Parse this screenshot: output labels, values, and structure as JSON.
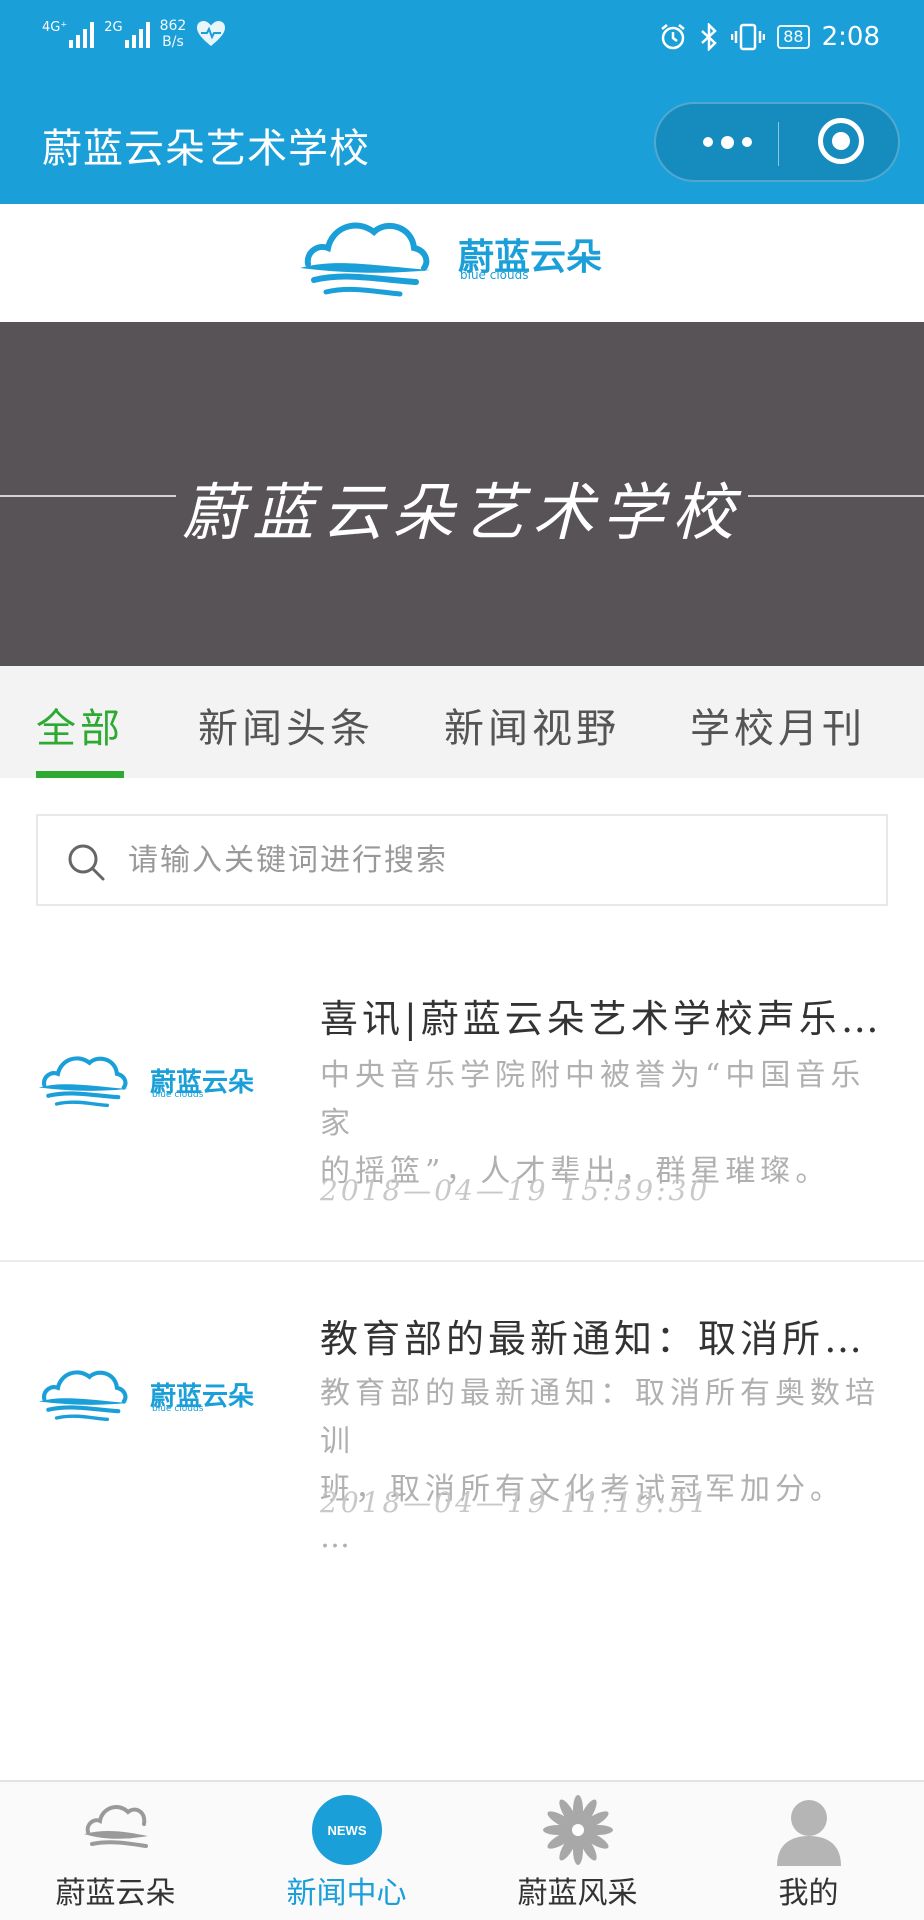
{
  "status_bar": {
    "network_left": "4G⁺",
    "network_right": "2G",
    "speed_value": "862",
    "speed_unit": "B/s",
    "battery": "88",
    "time": "2:08"
  },
  "header": {
    "title": "蔚蓝云朵艺术学校",
    "more_icon": "more-dots-icon",
    "close_icon": "target-circle-icon",
    "brand_color": "#1a9fd9"
  },
  "logo": {
    "name": "蔚蓝云朵",
    "sub": "blue clouds"
  },
  "banner": {
    "title": "蔚蓝云朵艺术学校"
  },
  "tabs": {
    "items": [
      {
        "label": "全部"
      },
      {
        "label": "新闻头条"
      },
      {
        "label": "新闻视野"
      },
      {
        "label": "学校月刊"
      }
    ],
    "active": "全部",
    "active_color": "#2eaa33"
  },
  "search": {
    "placeholder": "请输入关键词进行搜索",
    "value": ""
  },
  "news": [
    {
      "title": "喜讯|蔚蓝云朵艺术学校声乐…",
      "summary_line1": "中央音乐学院附中被誉为“中国音乐家",
      "summary_line2": "的摇篮”，人才辈出，群星璀璨。",
      "date": "2018—04—19  15:59:30"
    },
    {
      "title": "教育部的最新通知：取消所…",
      "summary_line1": "教育部的最新通知：取消所有奥数培训",
      "summary_line2": "班，取消所有文化考试冠军加分。 …",
      "date": "2018—04—19  11:19:51"
    }
  ],
  "tabbar": {
    "items": [
      {
        "label": "蔚蓝云朵",
        "icon": "cloud-icon"
      },
      {
        "label": "新闻中心",
        "icon": "news-icon",
        "icon_text": "NEWS"
      },
      {
        "label": "蔚蓝风采",
        "icon": "flower-icon"
      },
      {
        "label": "我的",
        "icon": "user-icon"
      }
    ],
    "active": "新闻中心"
  }
}
